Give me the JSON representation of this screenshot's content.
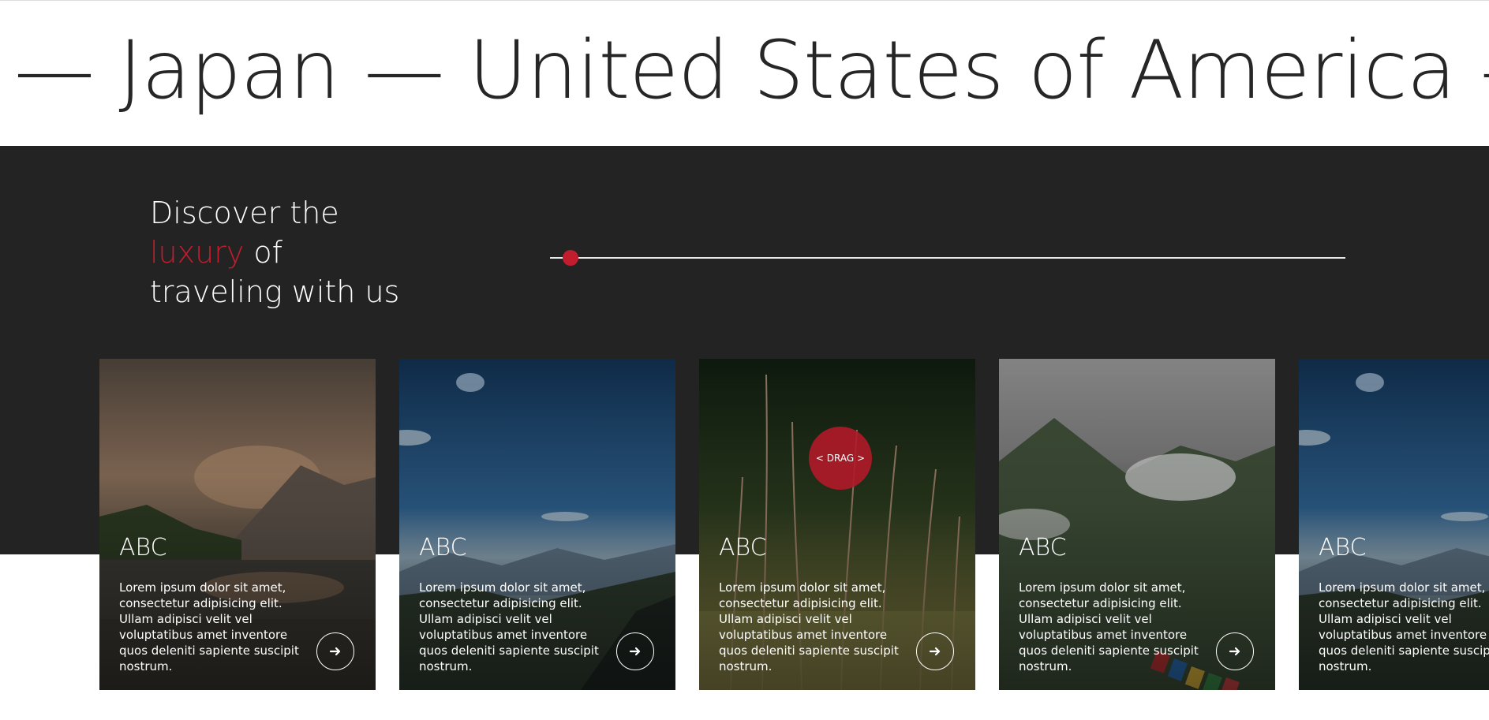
{
  "marquee": {
    "text": "— Japan — United States of America — T"
  },
  "headline": {
    "line1": "Discover the",
    "accent": "luxury",
    "line2_rest": " of",
    "line3": "traveling with us"
  },
  "drag": {
    "label": "< DRAG >"
  },
  "cards": [
    {
      "title": "ABC",
      "description": "Lorem ipsum dolor sit amet, consectetur adipisicing elit. Ullam adipisci velit vel voluptatibus amet inventore quos deleniti sapiente suscipit nostrum.",
      "icon": "arrow-right-icon",
      "photo": "mountain-lake-sunset"
    },
    {
      "title": "ABC",
      "description": "Lorem ipsum dolor sit amet, consectetur adipisicing elit. Ullam adipisci velit vel voluptatibus amet inventore quos deleniti sapiente suscipit nostrum.",
      "icon": "arrow-right-icon",
      "photo": "blue-sky-mountains"
    },
    {
      "title": "ABC",
      "description": "Lorem ipsum dolor sit amet, consectetur adipisicing elit. Ullam adipisci velit vel voluptatibus amet inventore quos deleniti sapiente suscipit nostrum.",
      "icon": "arrow-right-icon",
      "photo": "meadow-grass"
    },
    {
      "title": "ABC",
      "description": "Lorem ipsum dolor sit amet, consectetur adipisicing elit. Ullam adipisci velit vel voluptatibus amet inventore quos deleniti sapiente suscipit nostrum.",
      "icon": "arrow-right-icon",
      "photo": "foggy-mountain-flags"
    },
    {
      "title": "ABC",
      "description": "Lorem ipsum dolor sit amet, consectetur adipisicing elit. Ullam adipisci velit vel voluptatibus amet inventore quos deleniti sapiente suscipit nostrum.",
      "icon": "arrow-right-icon",
      "photo": "blue-sky-mountains"
    }
  ],
  "slider": {
    "position": 0.02
  },
  "colors": {
    "accent": "#c21d2e",
    "dark_band": "#232323",
    "text_dark": "#262626"
  }
}
